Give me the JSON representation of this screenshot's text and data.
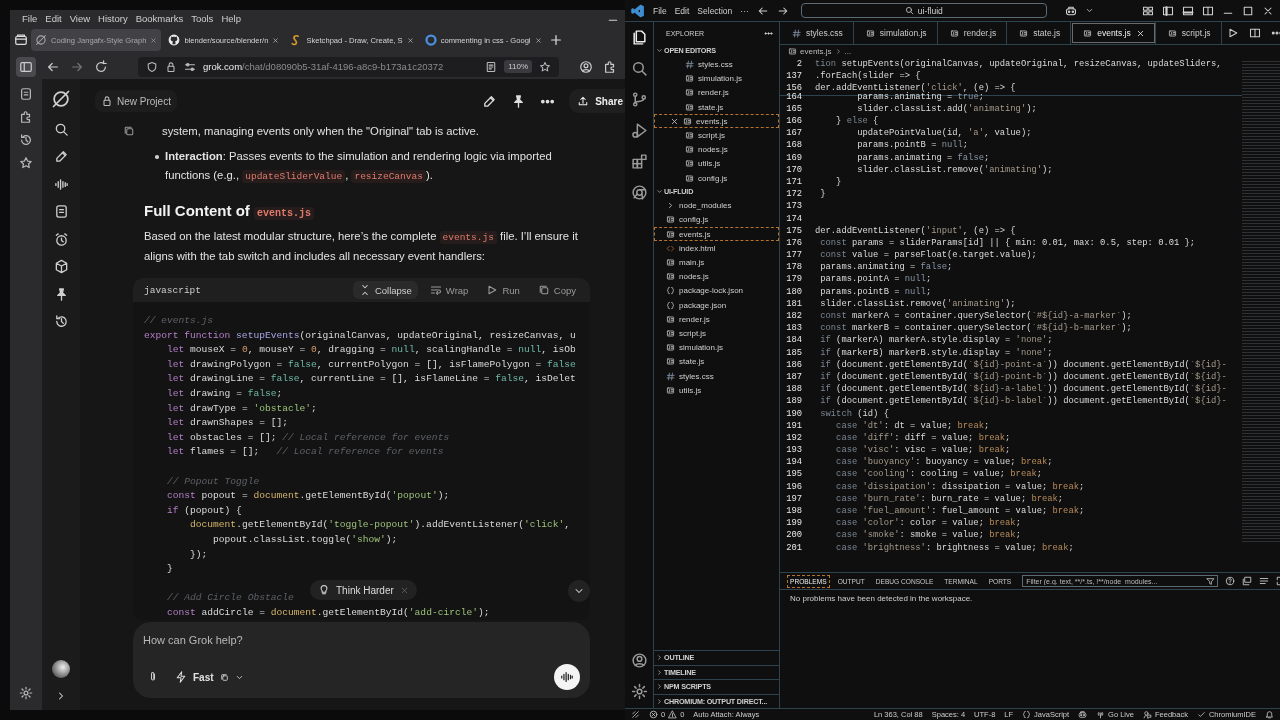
{
  "browser": {
    "menu": [
      "File",
      "Edit",
      "View",
      "History",
      "Bookmarks",
      "Tools",
      "Help"
    ],
    "tabs": [
      {
        "title": "Coding Jangafx-Style Graph",
        "kind": "grok",
        "selected": true
      },
      {
        "title": "blender/source/blender/n",
        "kind": "github",
        "selected": false
      },
      {
        "title": "Sketchpad - Draw, Create, S",
        "kind": "sketchpad",
        "selected": false
      },
      {
        "title": "commenting in css - Googl",
        "kind": "google",
        "selected": false
      }
    ],
    "address": {
      "host": "grok.com",
      "path": "/chat/d08090b5-31af-4196-a8c9-b173a1c20372"
    },
    "zoom": "110%"
  },
  "grok": {
    "project": "New Project",
    "share": "Share",
    "blocks": [
      {
        "kind": "continuation",
        "segments": [
          "system, managing events only when the \"Original\" tab is active."
        ]
      },
      {
        "kind": "bullet",
        "segments": [
          {
            "text": "Interaction",
            "kind": "bold"
          },
          ": Passes events to the simulation and rendering logic via imported functions (e.g., ",
          {
            "text": "updateSliderValue",
            "kind": "code"
          },
          ", ",
          {
            "text": "resizeCanvas",
            "kind": "code"
          },
          ")."
        ]
      },
      {
        "kind": "heading",
        "segments": [
          "Full Content of ",
          {
            "text": "events.js",
            "kind": "code"
          }
        ]
      },
      {
        "kind": "text",
        "segments": [
          "Based on the latest modular structure, here’s the complete ",
          {
            "text": "events.js",
            "kind": "code"
          },
          " file. I’ll ensure it aligns with the tab switch and includes all necessary event handlers:"
        ]
      },
      {
        "kind": "code",
        "language": "javascript",
        "actions": [
          {
            "label": "Collapse",
            "kind": "collapse",
            "hovered": true
          },
          {
            "label": "Wrap",
            "kind": "wrap",
            "hovered": false
          },
          {
            "label": "Run",
            "kind": "run",
            "hovered": false
          },
          {
            "label": "Copy",
            "kind": "copy",
            "hovered": false
          }
        ],
        "lines": [
          {
            "kind": "code",
            "code": [
              {
                "text": "// events.js",
                "kind": "cm"
              }
            ]
          },
          {
            "kind": "code",
            "code": [
              {
                "text": "export function",
                "kind": "kw"
              },
              {
                "text": " setupEvents",
                "kind": "fn"
              },
              "(originalCanvas, updateOriginal, resizeCanvas, u"
            ]
          },
          {
            "kind": "code",
            "code": [
              {
                "text": "    let",
                "kind": "kw"
              },
              " mouseX = ",
              {
                "text": "0",
                "kind": "num"
              },
              ", mouseY = ",
              {
                "text": "0",
                "kind": "num"
              },
              ", dragging = ",
              {
                "text": "null",
                "kind": "lit"
              },
              ", scalingHandle = ",
              {
                "text": "null",
                "kind": "lit"
              },
              ", isOb"
            ]
          },
          {
            "kind": "code",
            "code": [
              {
                "text": "    let",
                "kind": "kw"
              },
              " drawingPolygon = ",
              {
                "text": "false",
                "kind": "lit"
              },
              ", currentPolygon = [], isFlamePolygon = ",
              {
                "text": "false",
                "kind": "lit"
              }
            ]
          },
          {
            "kind": "code",
            "code": [
              {
                "text": "    let",
                "kind": "kw"
              },
              " drawingLine = ",
              {
                "text": "false",
                "kind": "lit"
              },
              ", currentLine = [], isFlameLine = ",
              {
                "text": "false",
                "kind": "lit"
              },
              ", isDelet"
            ]
          },
          {
            "kind": "code",
            "code": [
              {
                "text": "    let",
                "kind": "kw"
              },
              " drawing = ",
              {
                "text": "false",
                "kind": "lit"
              },
              ";"
            ]
          },
          {
            "kind": "code",
            "code": [
              {
                "text": "    let",
                "kind": "kw"
              },
              " drawType = ",
              {
                "text": "'obstacle'",
                "kind": "str"
              },
              ";"
            ]
          },
          {
            "kind": "code",
            "code": [
              {
                "text": "    let",
                "kind": "kw"
              },
              " drawnShapes = [];"
            ]
          },
          {
            "kind": "code",
            "code": [
              {
                "text": "    let",
                "kind": "kw"
              },
              " obstacles = []; ",
              {
                "text": "// Local reference for events",
                "kind": "cm"
              }
            ]
          },
          {
            "kind": "code",
            "code": [
              {
                "text": "    let",
                "kind": "kw"
              },
              " flames = [];   ",
              {
                "text": "// Local reference for events",
                "kind": "cm"
              }
            ]
          },
          {
            "kind": "blank"
          },
          {
            "kind": "code",
            "code": [
              {
                "text": "    // Popout Toggle",
                "kind": "cm"
              }
            ]
          },
          {
            "kind": "code",
            "code": [
              {
                "text": "    const",
                "kind": "kw"
              },
              " popout = ",
              {
                "text": "document",
                "kind": "obj"
              },
              ".getElementById(",
              {
                "text": "'popout'",
                "kind": "str"
              },
              ");"
            ]
          },
          {
            "kind": "code",
            "code": [
              {
                "text": "    if",
                "kind": "kw"
              },
              " (popout) {"
            ]
          },
          {
            "kind": "code",
            "code": [
              {
                "text": "        document",
                "kind": "obj"
              },
              ".getElementById(",
              {
                "text": "'toggle-popout'",
                "kind": "str"
              },
              ").addEventListener(",
              {
                "text": "'click'",
                "kind": "str"
              },
              ","
            ]
          },
          {
            "kind": "code",
            "code": [
              "            popout.classList.toggle(",
              {
                "text": "'show'",
                "kind": "str"
              },
              ");"
            ]
          },
          {
            "kind": "code",
            "code": [
              "        });"
            ]
          },
          {
            "kind": "code",
            "code": [
              "    }"
            ]
          },
          {
            "kind": "blank"
          },
          {
            "kind": "code",
            "code": [
              {
                "text": "    // Add Circle Obstacle",
                "kind": "cm"
              }
            ]
          },
          {
            "kind": "code",
            "code": [
              {
                "text": "    const",
                "kind": "kw"
              },
              " addCircle = ",
              {
                "text": "document",
                "kind": "obj"
              },
              ".getElementById(",
              {
                "text": "'add-circle'",
                "kind": "str"
              },
              ");"
            ]
          }
        ]
      }
    ],
    "chip": "Think Harder",
    "input": {
      "placeholder": "How can Grok help?"
    },
    "mode": "Fast"
  },
  "vscode": {
    "menu": [
      "File",
      "Edit",
      "Selection",
      "···"
    ],
    "search": "ui-fluid",
    "tabs": [
      {
        "label": "styles.css",
        "kind": "css",
        "selected": false
      },
      {
        "label": "simulation.js",
        "kind": "js",
        "selected": false
      },
      {
        "label": "render.js",
        "kind": "js",
        "selected": false
      },
      {
        "label": "state.js",
        "kind": "js",
        "selected": false
      },
      {
        "label": "events.js",
        "kind": "js",
        "selected": true
      },
      {
        "label": "script.js",
        "kind": "js",
        "selected": false
      }
    ],
    "breadcrumb": [
      "events.js",
      "..."
    ],
    "explorer": {
      "title": "EXPLORER",
      "sections": [
        {
          "title": "OPEN EDITORS",
          "expanded": true,
          "items": [
            {
              "name": "styles.css",
              "kind": "css",
              "selected": false
            },
            {
              "name": "simulation.js",
              "kind": "js",
              "selected": false
            },
            {
              "name": "render.js",
              "kind": "js",
              "selected": false
            },
            {
              "name": "state.js",
              "kind": "js",
              "selected": false
            },
            {
              "name": "events.js",
              "kind": "js",
              "selected": true
            },
            {
              "name": "script.js",
              "kind": "js",
              "selected": false
            },
            {
              "name": "nodes.js",
              "kind": "js",
              "selected": false
            },
            {
              "name": "utils.js",
              "kind": "js",
              "selected": false
            },
            {
              "name": "config.js",
              "kind": "js",
              "selected": false
            }
          ]
        },
        {
          "title": "UI-FLUID",
          "expanded": true,
          "items": [
            {
              "name": "node_modules",
              "kind": "folder",
              "selected": false
            },
            {
              "name": "config.js",
              "kind": "js",
              "selected": false
            },
            {
              "name": "events.js",
              "kind": "js",
              "selected": true
            },
            {
              "name": "index.html",
              "kind": "html",
              "selected": false
            },
            {
              "name": "main.js",
              "kind": "js",
              "selected": false
            },
            {
              "name": "nodes.js",
              "kind": "js",
              "selected": false
            },
            {
              "name": "package-lock.json",
              "kind": "json",
              "selected": false
            },
            {
              "name": "package.json",
              "kind": "json",
              "selected": false
            },
            {
              "name": "render.js",
              "kind": "js",
              "selected": false
            },
            {
              "name": "script.js",
              "kind": "js",
              "selected": false
            },
            {
              "name": "simulation.js",
              "kind": "js",
              "selected": false
            },
            {
              "name": "state.js",
              "kind": "js",
              "selected": false
            },
            {
              "name": "styles.css",
              "kind": "css",
              "selected": false
            },
            {
              "name": "utils.js",
              "kind": "js",
              "selected": false
            }
          ]
        },
        {
          "title": "OUTLINE",
          "expanded": false
        },
        {
          "title": "TIMELINE",
          "expanded": false
        },
        {
          "title": "NPM SCRIPTS",
          "expanded": false
        },
        {
          "title": "CHROMIUM: OUTPUT DIRECT...",
          "expanded": false
        }
      ]
    },
    "sticky_lines": [
      {
        "number": "2",
        "code": [
          {
            "text": "tion",
            "kind": "kw"
          },
          " setupEvents(originalCanvas, updateOriginal, resizeCanvas, updateSliders,"
        ]
      },
      {
        "number": "137",
        "code": [
          ".forEach(slider => {"
        ]
      },
      {
        "number": "156",
        "code": [
          "der.addEventListener(",
          {
            "text": "'click'",
            "kind": "str"
          },
          ", (e) => {"
        ]
      }
    ],
    "lines": [
      {
        "number": "164",
        "code": [
          "        params.animating = ",
          {
            "text": "true",
            "kind": "lit"
          },
          ";"
        ]
      },
      {
        "number": "165",
        "code": [
          "        slider.classList.add(",
          {
            "text": "'animating'",
            "kind": "str"
          },
          ");"
        ]
      },
      {
        "number": "166",
        "code": [
          "    } ",
          {
            "text": "else",
            "kind": "kw"
          },
          " {"
        ]
      },
      {
        "number": "167",
        "code": [
          "        updatePointValue(id, ",
          {
            "text": "'a'",
            "kind": "str"
          },
          ", value);"
        ]
      },
      {
        "number": "168",
        "code": [
          "        params.pointB = ",
          {
            "text": "null",
            "kind": "lit"
          },
          ";"
        ]
      },
      {
        "number": "169",
        "code": [
          "        params.animating = ",
          {
            "text": "false",
            "kind": "lit"
          },
          ";"
        ]
      },
      {
        "number": "170",
        "code": [
          "        slider.classList.remove(",
          {
            "text": "'animating'",
            "kind": "str"
          },
          ");"
        ]
      },
      {
        "number": "171",
        "code": [
          "    }"
        ]
      },
      {
        "number": "172",
        "code": [
          " }"
        ]
      },
      {
        "number": "173"
      },
      {
        "number": "174"
      },
      {
        "number": "175",
        "code": [
          "der.addEventListener(",
          {
            "text": "'input'",
            "kind": "str"
          },
          ", (e) => {"
        ]
      },
      {
        "number": "176",
        "code": [
          {
            "text": " const",
            "kind": "kw"
          },
          " params = sliderParams[id] || { min: 0.01, max: 0.5, step: 0.01 };"
        ]
      },
      {
        "number": "177",
        "code": [
          {
            "text": " const",
            "kind": "kw"
          },
          " value = parseFloat(e.target.value);"
        ]
      },
      {
        "number": "178",
        "code": [
          " params.animating = ",
          {
            "text": "false",
            "kind": "lit"
          },
          ";"
        ]
      },
      {
        "number": "179",
        "code": [
          " params.pointA = ",
          {
            "text": "null",
            "kind": "lit"
          },
          ";"
        ]
      },
      {
        "number": "180",
        "code": [
          " params.pointB = ",
          {
            "text": "null",
            "kind": "lit"
          },
          ";"
        ]
      },
      {
        "number": "181",
        "code": [
          " slider.classList.remove(",
          {
            "text": "'animating'",
            "kind": "str"
          },
          ");"
        ]
      },
      {
        "number": "182",
        "code": [
          {
            "text": " const",
            "kind": "kw"
          },
          " markerA = container.querySelector(",
          {
            "text": "`#${id}-a-marker`",
            "kind": "str"
          },
          ");"
        ]
      },
      {
        "number": "183",
        "code": [
          {
            "text": " const",
            "kind": "kw"
          },
          " markerB = container.querySelector(",
          {
            "text": "`#${id}-b-marker`",
            "kind": "str"
          },
          ");"
        ]
      },
      {
        "number": "184",
        "code": [
          {
            "text": " if",
            "kind": "kw"
          },
          " (markerA) markerA.style.display = ",
          {
            "text": "'none'",
            "kind": "str"
          },
          ";"
        ]
      },
      {
        "number": "185",
        "code": [
          {
            "text": " if",
            "kind": "kw"
          },
          " (markerB) markerB.style.display = ",
          {
            "text": "'none'",
            "kind": "str"
          },
          ";"
        ]
      },
      {
        "number": "186",
        "code": [
          {
            "text": " if",
            "kind": "kw"
          },
          " (document.getElementById(",
          {
            "text": "`${id}-point-a`",
            "kind": "str"
          },
          ")) document.getElementById(",
          {
            "text": "`${id}-",
            "kind": "str"
          }
        ]
      },
      {
        "number": "187",
        "code": [
          {
            "text": " if",
            "kind": "kw"
          },
          " (document.getElementById(",
          {
            "text": "`${id}-point-b`",
            "kind": "str"
          },
          ")) document.getElementById(",
          {
            "text": "`${id}-",
            "kind": "str"
          }
        ]
      },
      {
        "number": "188",
        "code": [
          {
            "text": " if",
            "kind": "kw"
          },
          " (document.getElementById(",
          {
            "text": "`${id}-a-label`",
            "kind": "str"
          },
          ")) document.getElementById(",
          {
            "text": "`${id}-",
            "kind": "str"
          }
        ]
      },
      {
        "number": "189",
        "code": [
          {
            "text": " if",
            "kind": "kw"
          },
          " (document.getElementById(",
          {
            "text": "`${id}-b-label`",
            "kind": "str"
          },
          ")) document.getElementById(",
          {
            "text": "`${id}-",
            "kind": "str"
          }
        ]
      },
      {
        "number": "190",
        "code": [
          {
            "text": " switch",
            "kind": "kw"
          },
          " (id) {"
        ]
      },
      {
        "number": "191",
        "code": [
          {
            "text": "    case",
            "kind": "kw"
          },
          {
            "text": " 'dt'",
            "kind": "str"
          },
          ": dt = value; ",
          {
            "text": "break",
            "kind": "brk"
          },
          ";"
        ]
      },
      {
        "number": "192",
        "code": [
          {
            "text": "    case",
            "kind": "kw"
          },
          {
            "text": " 'diff'",
            "kind": "str"
          },
          ": diff = value; ",
          {
            "text": "break",
            "kind": "brk"
          },
          ";"
        ]
      },
      {
        "number": "193",
        "code": [
          {
            "text": "    case",
            "kind": "kw"
          },
          {
            "text": " 'visc'",
            "kind": "str"
          },
          ": visc = value; ",
          {
            "text": "break",
            "kind": "brk"
          },
          ";"
        ]
      },
      {
        "number": "194",
        "code": [
          {
            "text": "    case",
            "kind": "kw"
          },
          {
            "text": " 'buoyancy'",
            "kind": "str"
          },
          ": buoyancy = value; ",
          {
            "text": "break",
            "kind": "brk"
          },
          ";"
        ]
      },
      {
        "number": "195",
        "code": [
          {
            "text": "    case",
            "kind": "kw"
          },
          {
            "text": " 'cooling'",
            "kind": "str"
          },
          ": cooling = value; ",
          {
            "text": "break",
            "kind": "brk"
          },
          ";"
        ]
      },
      {
        "number": "196",
        "code": [
          {
            "text": "    case",
            "kind": "kw"
          },
          {
            "text": " 'dissipation'",
            "kind": "str"
          },
          ": dissipation = value; ",
          {
            "text": "break",
            "kind": "brk"
          },
          ";"
        ]
      },
      {
        "number": "197",
        "code": [
          {
            "text": "    case",
            "kind": "kw"
          },
          {
            "text": " 'burn_rate'",
            "kind": "str"
          },
          ": burn_rate = value; ",
          {
            "text": "break",
            "kind": "brk"
          },
          ";"
        ]
      },
      {
        "number": "198",
        "code": [
          {
            "text": "    case",
            "kind": "kw"
          },
          {
            "text": " 'fuel_amount'",
            "kind": "str"
          },
          ": fuel_amount = value; ",
          {
            "text": "break",
            "kind": "brk"
          },
          ";"
        ]
      },
      {
        "number": "199",
        "code": [
          {
            "text": "    case",
            "kind": "kw"
          },
          {
            "text": " 'color'",
            "kind": "str"
          },
          ": color = value; ",
          {
            "text": "break",
            "kind": "brk"
          },
          ";"
        ]
      },
      {
        "number": "200",
        "code": [
          {
            "text": "    case",
            "kind": "kw"
          },
          {
            "text": " 'smoke'",
            "kind": "str"
          },
          ": smoke = value; ",
          {
            "text": "break",
            "kind": "brk"
          },
          ";"
        ]
      },
      {
        "number": "201",
        "code": [
          {
            "text": "    case",
            "kind": "kw"
          },
          {
            "text": " 'brightness'",
            "kind": "str"
          },
          ": brightness = value; ",
          {
            "text": "break",
            "kind": "brk"
          },
          ";"
        ]
      }
    ],
    "panel": {
      "tabs": [
        {
          "label": "PROBLEMS",
          "selected": true
        },
        {
          "label": "OUTPUT",
          "selected": false
        },
        {
          "label": "DEBUG CONSOLE",
          "selected": false
        },
        {
          "label": "TERMINAL",
          "selected": false
        },
        {
          "label": "PORTS",
          "selected": false
        }
      ],
      "filter": {
        "placeholder": "Filter (e.g. text, **/*.ts, !**/node_modules..."
      },
      "message": "No problems have been detected in the workspace."
    },
    "status": {
      "errors": "0",
      "warnings": "0",
      "left": [
        "Auto Attach: Always"
      ],
      "right": [
        {
          "text": "Ln 363, Col 88",
          "kind": "plain"
        },
        {
          "text": "Spaces: 4",
          "kind": "plain"
        },
        {
          "text": "UTF-8",
          "kind": "plain"
        },
        {
          "text": "LF",
          "kind": "plain"
        },
        {
          "text": "JavaScript",
          "kind": "braces"
        },
        {
          "kind": "copilot"
        },
        {
          "text": "Go Live",
          "kind": "broadcast"
        },
        {
          "text": "Feedback",
          "kind": "feedback"
        },
        {
          "text": "ChromiumIDE",
          "kind": "check"
        },
        {
          "kind": "bell"
        }
      ]
    }
  }
}
